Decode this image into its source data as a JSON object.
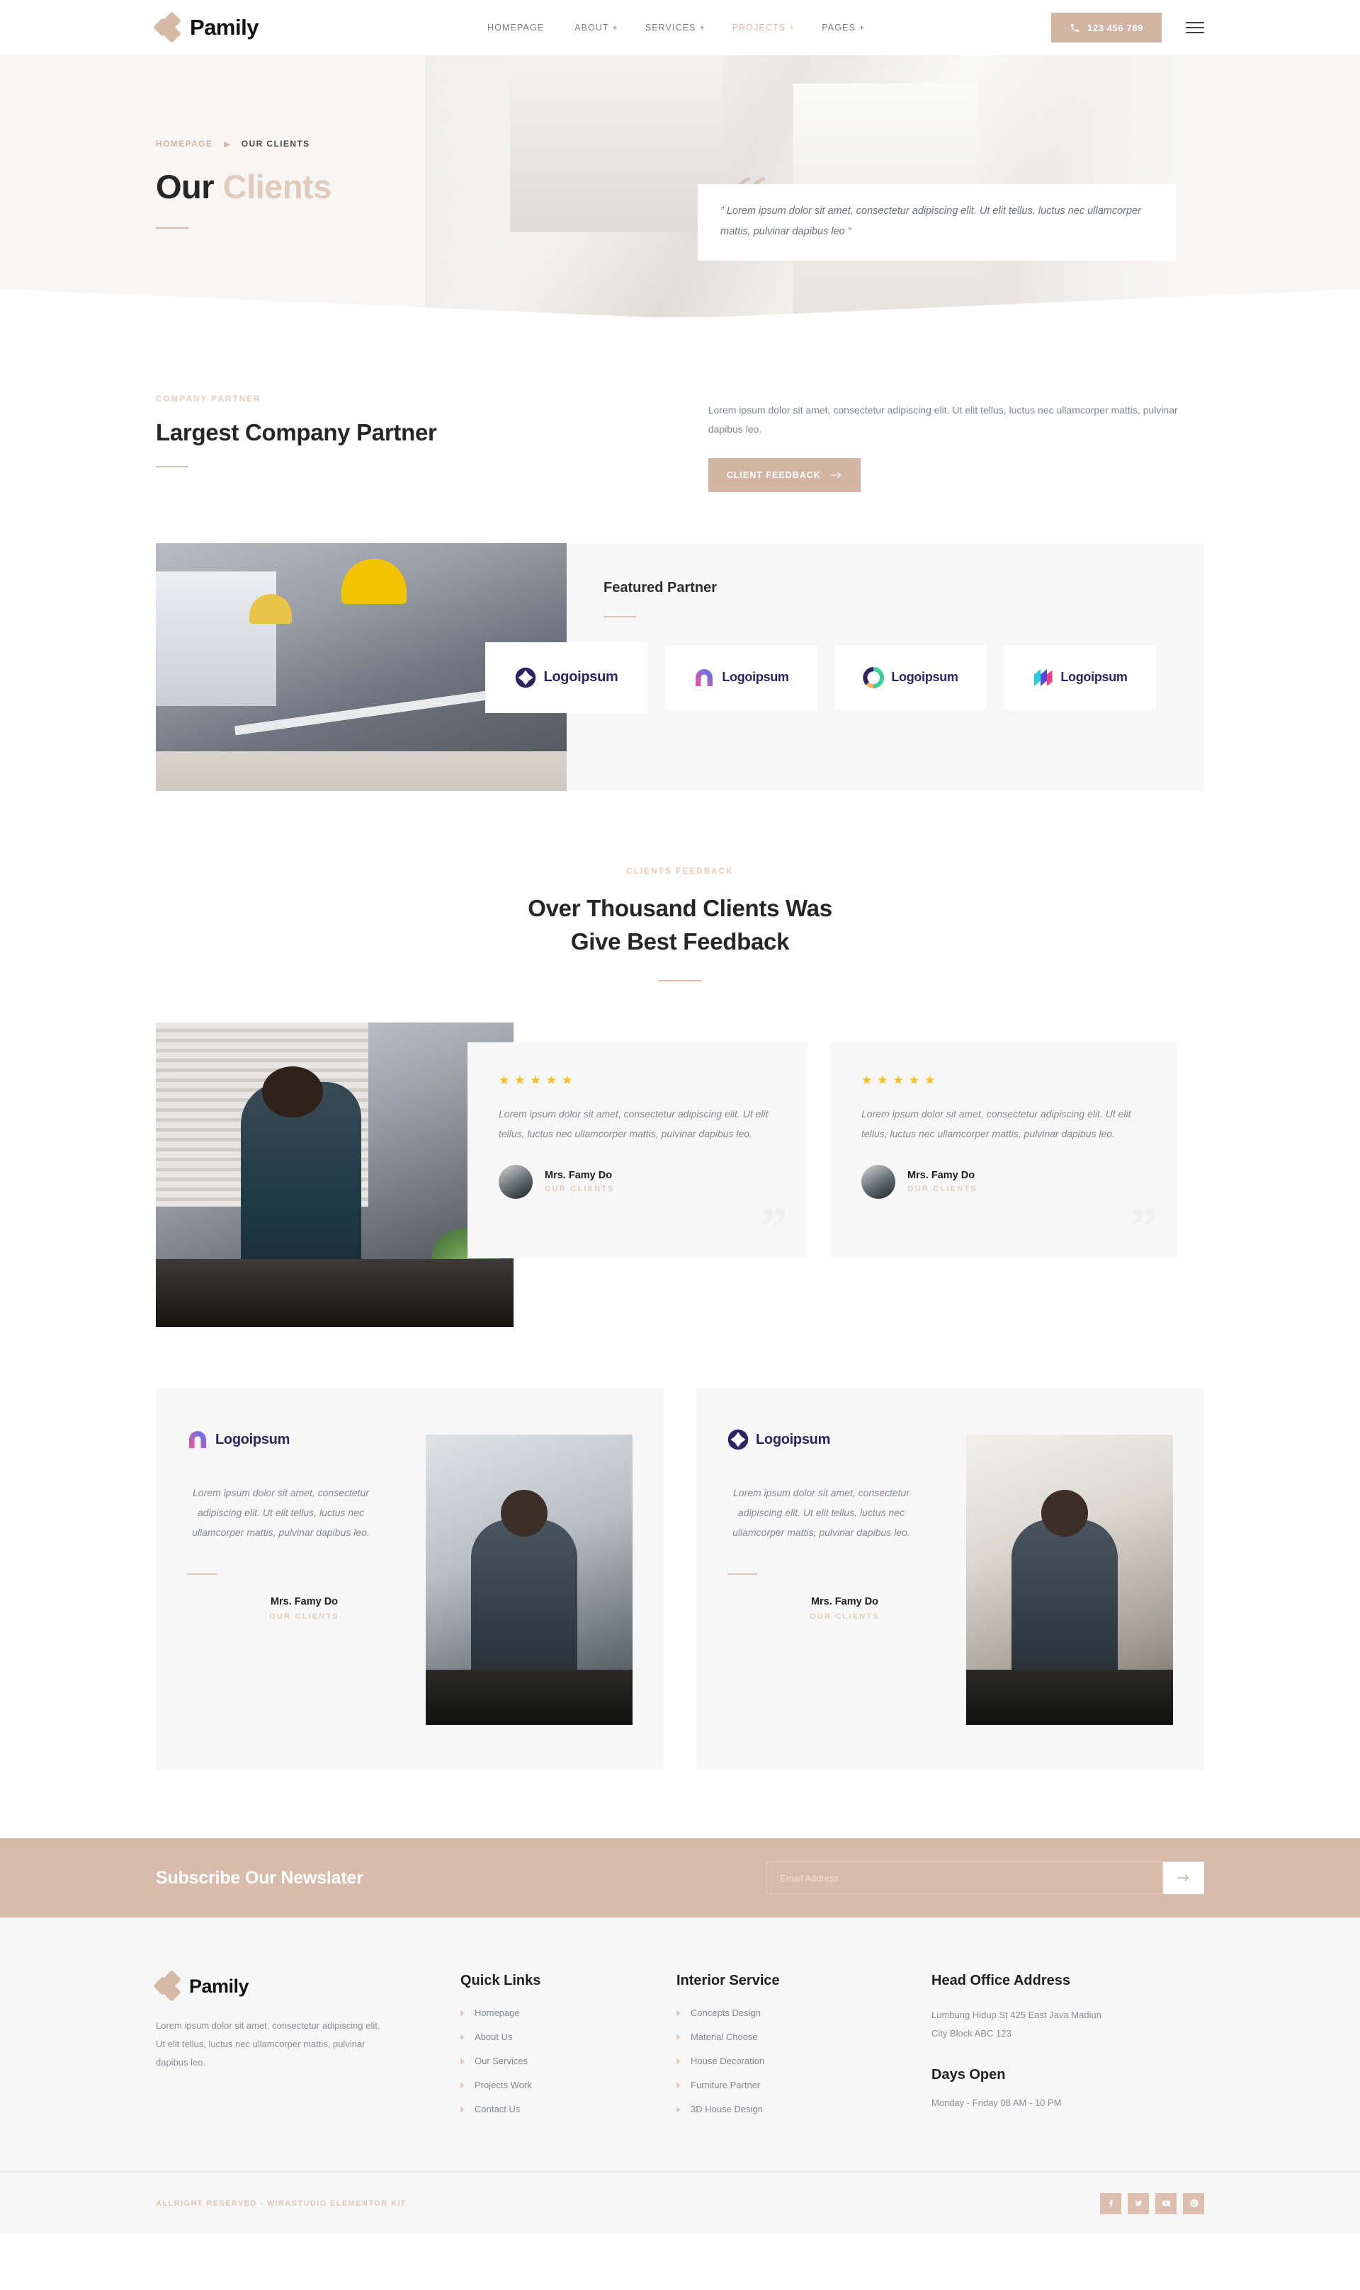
{
  "header": {
    "brand": "Pamily",
    "nav": [
      {
        "label": "HOMEPAGE",
        "caret": "",
        "active": false
      },
      {
        "label": "ABOUT",
        "caret": "+",
        "active": false
      },
      {
        "label": "SERVICES",
        "caret": "+",
        "active": false
      },
      {
        "label": "PROJECTS",
        "caret": "+",
        "active": true
      },
      {
        "label": "PAGES",
        "caret": "+",
        "active": false
      }
    ],
    "phone": "123 456 789",
    "phone_icon": "phone-ring-icon",
    "menu_icon": "hamburger-icon"
  },
  "hero": {
    "breadcrumb_home": "HOMEPAGE",
    "breadcrumb_sep": "▶",
    "breadcrumb_current": "OUR CLIENTS",
    "title_1": "Our ",
    "title_2": "Clients",
    "quote_mark": "“",
    "quote": "” Lorem ipsum dolor sit amet, consectetur adipiscing elit. Ut elit tellus, luctus nec ullamcorper mattis, pulvinar dapibus leo “"
  },
  "partner": {
    "eyebrow": "COMPANY PARTNER",
    "heading": "Largest Company Partner",
    "paragraph": "Lorem ipsum dolor sit amet, consectetur adipiscing elit. Ut elit tellus, luctus nec ullamcorper mattis, pulvinar dapibus leo.",
    "button": "CLIENT FEEDBACK",
    "button_icon": "arrow-right-icon",
    "featured_title": "Featured Partner",
    "logos": [
      {
        "name": "Logoipsum",
        "mark": "diamond-circle-green"
      },
      {
        "name": "Logoipsum",
        "mark": "arch-pink-blue"
      },
      {
        "name": "Logoipsum",
        "mark": "ring-teal-orange"
      },
      {
        "name": "Logoipsum",
        "mark": "slashes-blue-pink"
      }
    ]
  },
  "feedback": {
    "eyebrow": "CLIENTS FEEDBACK",
    "heading_line1": "Over Thousand Clients Was",
    "heading_line2": "Give Best Feedback",
    "stars": "★★★★★",
    "quote_bg": "”",
    "cards": [
      {
        "text": "Lorem ipsum dolor sit amet, consectetur adipiscing elit. Ut elit tellus, luctus nec ullamcorper mattis, pulvinar dapibus leo.",
        "name": "Mrs. Famy Do",
        "role": "OUR CLIENTS"
      },
      {
        "text": "Lorem ipsum dolor sit amet, consectetur adipiscing elit. Ut elit tellus, luctus nec ullamcorper mattis, pulvinar dapibus leo.",
        "name": "Mrs. Famy Do",
        "role": "OUR CLIENTS"
      }
    ]
  },
  "logo_cards": [
    {
      "logo": "Logoipsum",
      "mark": "arch-pink-blue",
      "text": "Lorem ipsum dolor sit amet, consectetur adipiscing elit. Ut elit tellus, luctus nec ullamcorper mattis, pulvinar dapibus leo.",
      "name": "Mrs. Famy Do",
      "role": "OUR CLIENTS"
    },
    {
      "logo": "Logoipsum",
      "mark": "diamond-circle-green",
      "text": "Lorem ipsum dolor sit amet, consectetur adipiscing elit. Ut elit tellus, luctus nec ullamcorper mattis, pulvinar dapibus leo.",
      "name": "Mrs. Famy Do",
      "role": "OUR CLIENTS"
    }
  ],
  "newsletter": {
    "title": "Subscribe Our Newslater",
    "placeholder": "Email Address",
    "value": "",
    "submit_icon": "arrow-right-icon"
  },
  "footer": {
    "brand": "Pamily",
    "description": "Lorem ipsum dolor sit amet, consectetur adipiscing elit. Ut elit tellus, luctus nec ullamcorper mattis, pulvinar dapibus leo.",
    "quick_links_title": "Quick Links",
    "quick_links": [
      "Homepage",
      "About Us",
      "Our Services",
      "Projects Work",
      "Contact Us"
    ],
    "services_title": "Interior Service",
    "services": [
      "Concepts Design",
      "Material Choose",
      "House Decoration",
      "Furniture Partner",
      "3D House Design"
    ],
    "address_title": "Head Office Address",
    "address_line1": "Lumbung Hidup St 425 East Java Madiun",
    "address_line2": "City Block ABC 123",
    "days_title": "Days Open",
    "days_value": "Monday - Friday 08 AM - 10 PM",
    "copyright": "ALLRIGHT RESERVED - WIRASTUDIO ELEMENTOR KIT",
    "socials": [
      "facebook-icon",
      "twitter-icon",
      "youtube-icon",
      "pinterest-icon"
    ]
  },
  "colors": {
    "accent": "#d4b4a3",
    "accent_light": "#e0cbbd",
    "star": "#fbbc21",
    "logo_purple": "#2d2461",
    "panel_bg": "#f7f7f7"
  }
}
